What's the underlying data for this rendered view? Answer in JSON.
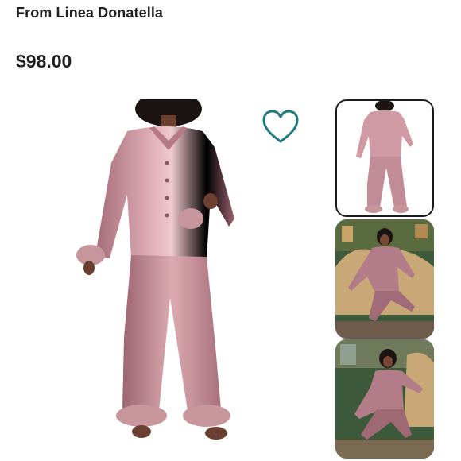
{
  "product": {
    "brand_line": "From Linea Donatella",
    "price": "$98.00"
  },
  "icons": {
    "favorite": "heart-outline-icon"
  },
  "colors": {
    "accent_teal": "#1f7a7f",
    "satin_mauve": "#c68f98",
    "satin_light": "#e7c0c6",
    "satin_dark": "#9c6470",
    "room_green": "#3d5a3a"
  },
  "gallery": {
    "selected_index": 0,
    "thumbnails": [
      {
        "name": "studio-front"
      },
      {
        "name": "vintage-room-seated"
      },
      {
        "name": "vintage-room-lounging"
      },
      {
        "name": "more"
      }
    ]
  }
}
